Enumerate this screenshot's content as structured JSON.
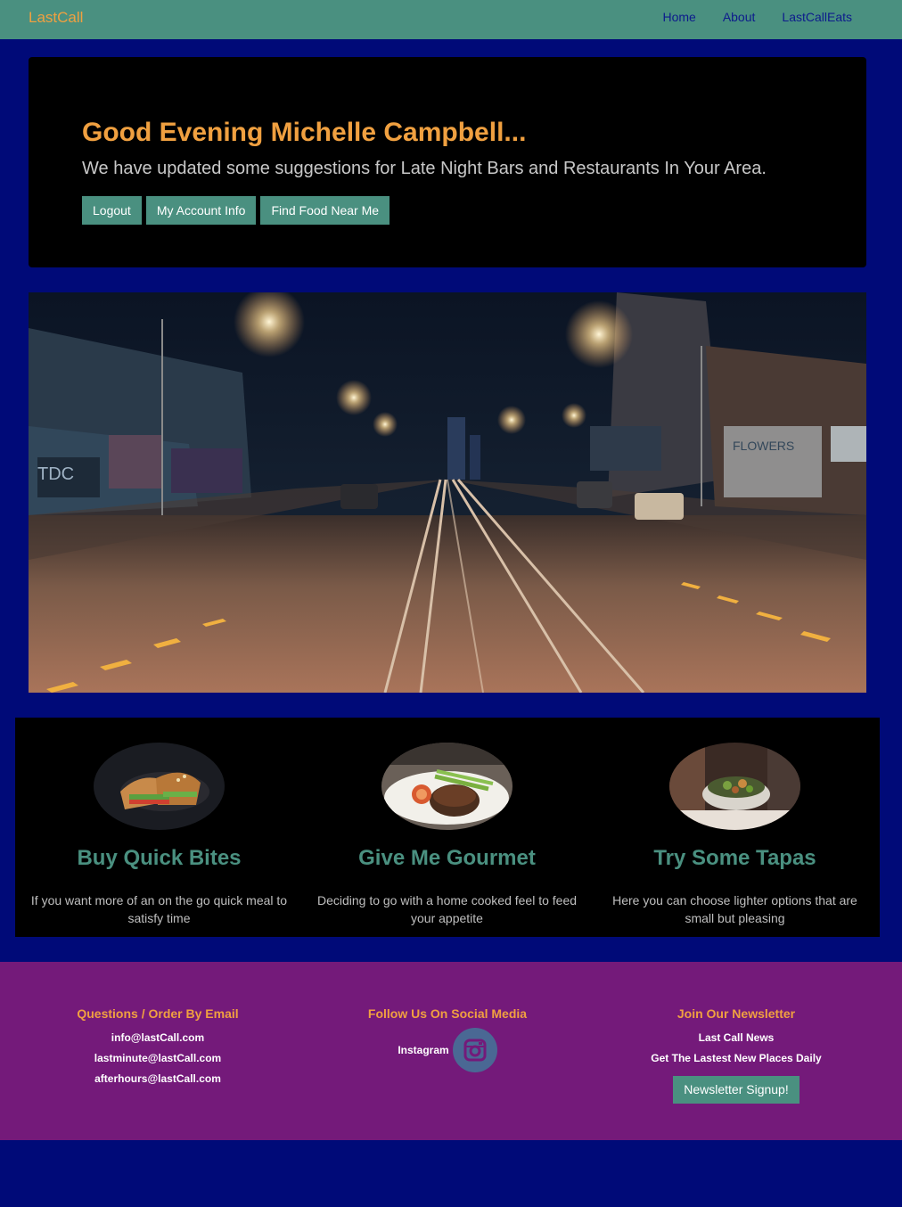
{
  "nav": {
    "brand": "LastCall",
    "links": [
      "Home",
      "About",
      "LastCallEats"
    ]
  },
  "hero": {
    "greeting": "Good Evening Michelle Campbell...",
    "subtext": "We have updated some suggestions for Late Night Bars and Restaurants In Your Area.",
    "buttons": [
      "Logout",
      "My Account Info",
      "Find Food Near Me"
    ]
  },
  "features": [
    {
      "title": "Buy Quick Bites",
      "text": "If you want more of an on the go quick meal to satisfy time"
    },
    {
      "title": "Give Me Gourmet",
      "text": "Deciding to go with a home cooked feel to feed your appetite"
    },
    {
      "title": "Try Some Tapas",
      "text": "Here you can choose lighter options that are small but pleasing"
    }
  ],
  "footer": {
    "contact": {
      "title": "Questions / Order By Email",
      "emails": [
        "info@lastCall.com",
        "lastminute@lastCall.com",
        "afterhours@lastCall.com"
      ]
    },
    "social": {
      "title": "Follow Us On Social Media",
      "label": "Instagram",
      "icon": "instagram-icon"
    },
    "newsletter": {
      "title": "Join Our Newsletter",
      "line1": "Last Call News",
      "line2": "Get The Lastest New Places Daily",
      "button": "Newsletter Signup!"
    }
  },
  "colors": {
    "page_bg": "#000a78",
    "nav_bg": "#4a9080",
    "accent_orange": "#f0a040",
    "teal": "#4a9080",
    "footer_bg": "#741a7a"
  }
}
